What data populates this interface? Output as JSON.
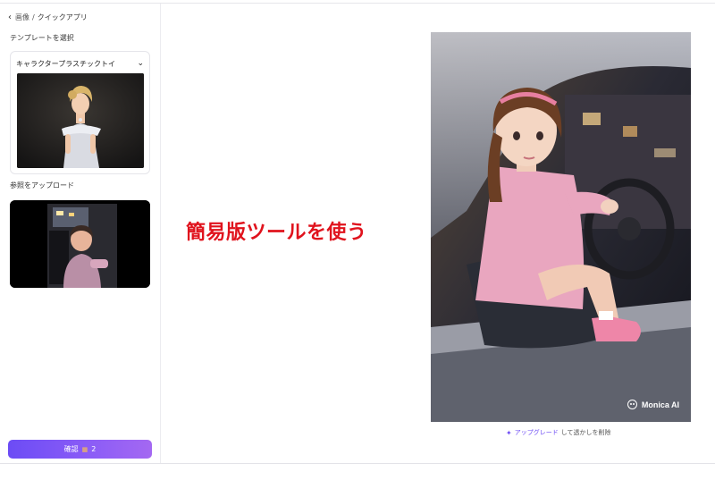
{
  "breadcrumb": {
    "back_icon": "chevron-left-icon",
    "parent": "画像",
    "separator": "/",
    "current": "クイックアプリ"
  },
  "template_section": {
    "label": "テンプレートを選択",
    "selected": "キャラクタープラスチックトイ"
  },
  "reference_section": {
    "label": "参照をアップロード"
  },
  "confirm_button": {
    "label": "確認",
    "credit_icon": "coin-icon",
    "credits": "2"
  },
  "overlay_caption": "簡易版ツールを使う",
  "result": {
    "watermark": "Monica AI"
  },
  "upgrade_notice": {
    "link": "アップグレード",
    "suffix": "して透かしを削除"
  },
  "colors": {
    "accent": "#6d4cf4",
    "caption_red": "#e0131d"
  }
}
